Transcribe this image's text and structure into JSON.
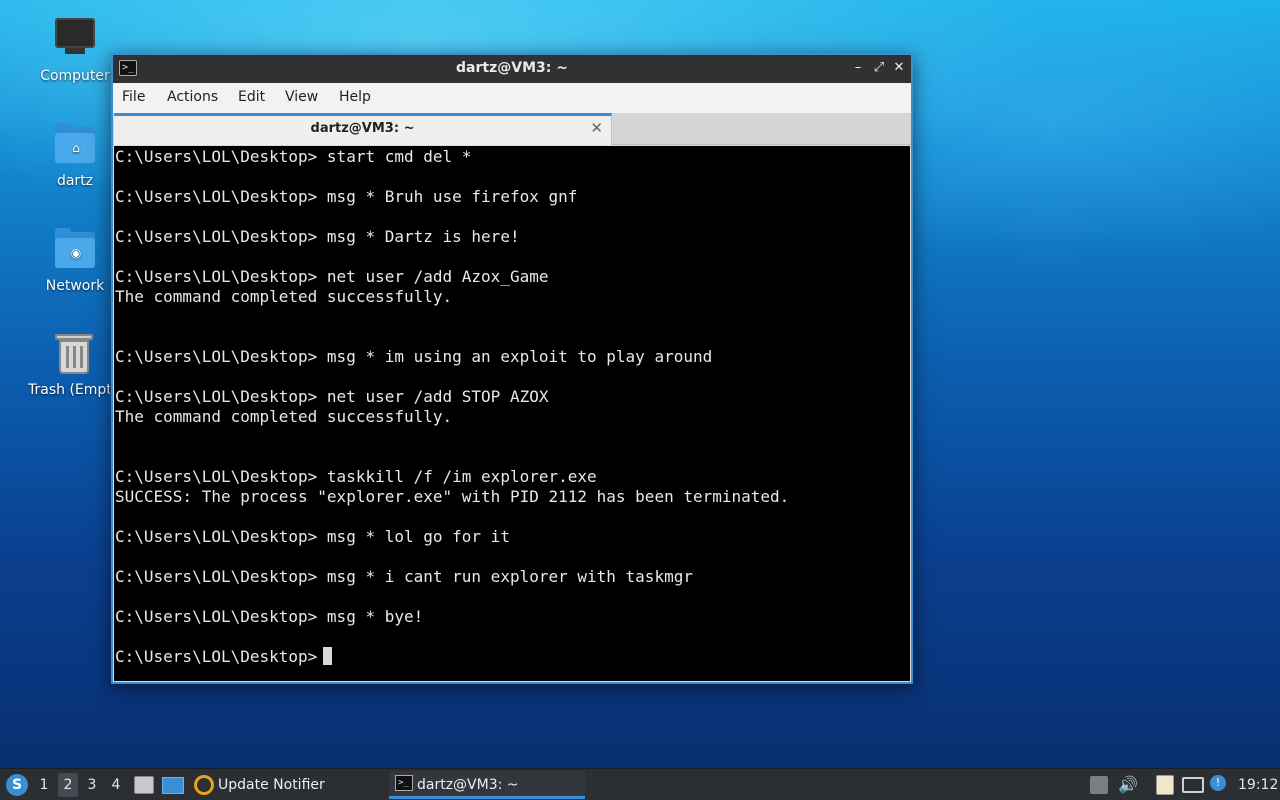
{
  "desktop": {
    "icons": [
      {
        "label": "Computer",
        "icon": "computer-icon"
      },
      {
        "label": "dartz",
        "icon": "home-folder-icon"
      },
      {
        "label": "Network",
        "icon": "network-folder-icon"
      },
      {
        "label": "Trash (Empt",
        "icon": "trash-icon"
      }
    ]
  },
  "window": {
    "title": "dartz@VM3: ~",
    "menu": [
      "File",
      "Actions",
      "Edit",
      "View",
      "Help"
    ],
    "tab": {
      "title": "dartz@VM3: ~"
    },
    "controls": {
      "minimize": "–",
      "maximize": "⤢",
      "close": "✕"
    },
    "terminal_lines": [
      "C:\\Users\\LOL\\Desktop> start cmd del *",
      "",
      "C:\\Users\\LOL\\Desktop> msg * Bruh use firefox gnf",
      "",
      "C:\\Users\\LOL\\Desktop> msg * Dartz is here!",
      "",
      "C:\\Users\\LOL\\Desktop> net user /add Azox_Game",
      "The command completed successfully.",
      "",
      "",
      "C:\\Users\\LOL\\Desktop> msg * im using an exploit to play around",
      "",
      "C:\\Users\\LOL\\Desktop> net user /add STOP AZOX",
      "The command completed successfully.",
      "",
      "",
      "C:\\Users\\LOL\\Desktop> taskkill /f /im explorer.exe",
      "SUCCESS: The process \"explorer.exe\" with PID 2112 has been terminated.",
      "",
      "C:\\Users\\LOL\\Desktop> msg * lol go for it",
      "",
      "C:\\Users\\LOL\\Desktop> msg * i cant run explorer with taskmgr",
      "",
      "C:\\Users\\LOL\\Desktop> msg * bye!",
      ""
    ],
    "prompt": "C:\\Users\\LOL\\Desktop>"
  },
  "taskbar": {
    "workspaces": [
      "1",
      "2",
      "3",
      "4"
    ],
    "active_workspace": "2",
    "tasks": [
      {
        "label": "Update Notifier",
        "icon": "update-notifier-icon"
      },
      {
        "label": "dartz@VM3: ~",
        "icon": "terminal-icon"
      }
    ],
    "clock": "19:12"
  },
  "colors": {
    "accent": "#3a8fd4",
    "terminal_bg": "#000000",
    "terminal_fg": "#e8e8e8",
    "taskbar_bg": "#2b2e33"
  }
}
